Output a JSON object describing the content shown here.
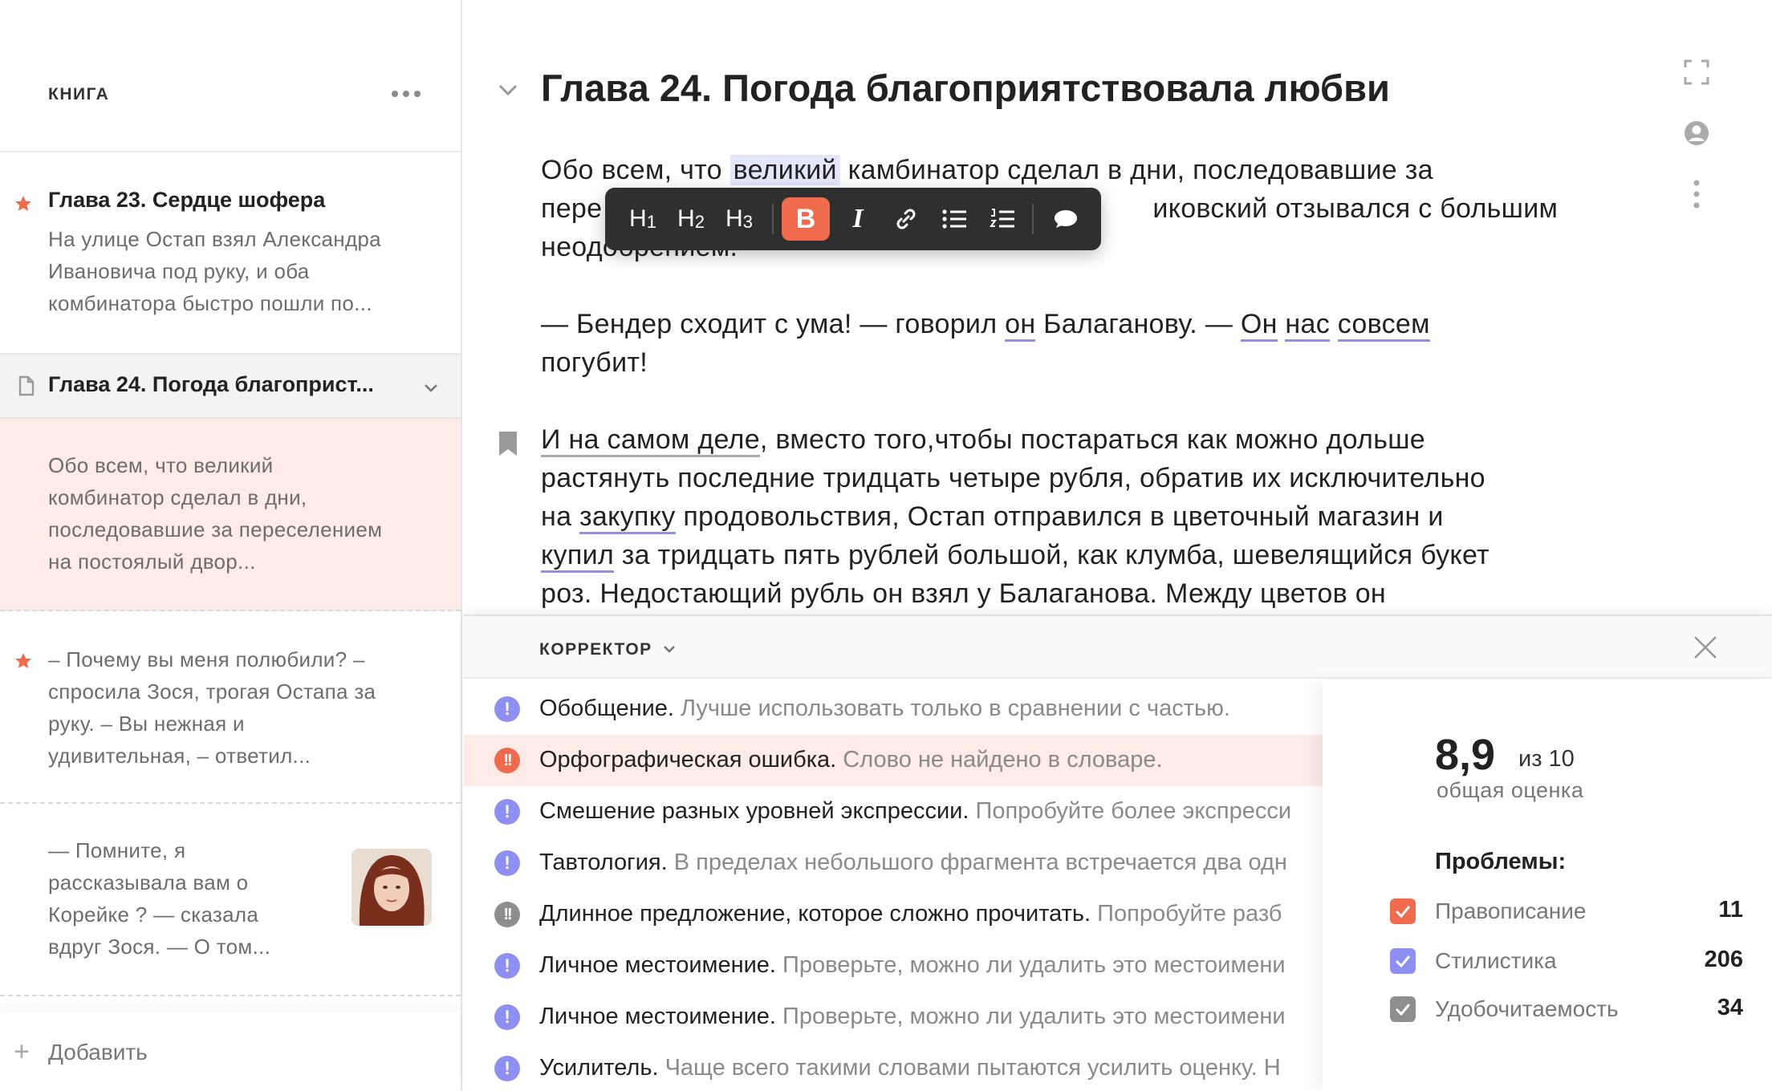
{
  "colors": {
    "accent": "#f06a4e",
    "violet": "#8e8ff2",
    "gray_badge": "#8e8e8e",
    "highlight": "#fdebe8"
  },
  "sidebar": {
    "title": "КНИГА",
    "items": [
      {
        "title": "Глава 23. Сердце шофера",
        "text_lines": [
          "На улице Остап взял Александра",
          "Ивановича под руку, и оба",
          "комбинатора быстро пошли по..."
        ],
        "starred": true
      },
      {
        "title": "Глава 24. Погода благоприст...",
        "icon": "document-icon"
      },
      {
        "text_lines": [
          "Обо всем, что великий",
          "комбинатор сделал в дни,",
          "последовавшие за переселением",
          "на постоялый двор..."
        ]
      },
      {
        "text_lines": [
          "– Почему вы меня полюбили? –",
          "спросила Зося, трогая Остапа за",
          "руку. – Вы нежная и",
          "удивительная, – ответил..."
        ],
        "starred": true
      },
      {
        "text_lines": [
          "— Помните, я",
          "рассказывала вам о",
          "Корейке ? — сказала",
          "вдруг Зося. — О том..."
        ],
        "has_avatar": true
      }
    ],
    "add_label": "Добавить"
  },
  "editor": {
    "title": "Глава 24. Погода благоприятствовала любви",
    "p1": {
      "a": "Обо всем, что ",
      "b": "великий",
      "c": " камбинатор сделал в дни, последовавшие за",
      "d": "пере",
      "e": "иковский отзывался с большим",
      "f": "неодобрением."
    },
    "p2": {
      "a": "— Бендер сходит с ума! — говорил ",
      "b": "он",
      "c": " Балаганову. — ",
      "d": "Он",
      "e": " ",
      "f": "нас",
      "g": " ",
      "h": "совсем",
      "i": "погубит!"
    },
    "p3": {
      "a": "И на самом деле",
      "b": ", вместо того,чтобы постараться как можно дольше",
      "c": "растянуть последние тридцать четыре рубля, обратив их исключительно",
      "d": "на ",
      "e": "закупку",
      "f": " продовольствия, Остап отправился в цветочный магазин и",
      "g": "купил",
      "h": " за тридцать пять рублей большой, как клумба, шевелящийся букет",
      "i": "роз. Недостающий рубль он взял у Балаганова. Между цветов он"
    },
    "toolbar": {
      "h1": "H",
      "h1n": "1",
      "h2": "H",
      "h2n": "2",
      "h3": "H",
      "h3n": "3",
      "bold": "B",
      "italic": "I"
    }
  },
  "corrector": {
    "title": "КОРРЕКТОР",
    "issues": [
      {
        "title": "Обобщение.",
        "desc": " Лучше использовать только в сравнении с частью.",
        "type": "style"
      },
      {
        "title": "Орфографическая ошибка.",
        "desc": " Слово не найдено в словаре.",
        "type": "spelling"
      },
      {
        "title": "Смешение разных уровней экспрессии.",
        "desc": " Попробуйте более экспресси",
        "type": "style"
      },
      {
        "title": "Тавтология.",
        "desc": " В пределах небольшого фрагмента встречается два одн",
        "type": "style"
      },
      {
        "title": "Длинное предложение, которое сложно прочитать.",
        "desc": " Попробуйте разб",
        "type": "readability"
      },
      {
        "title": "Личное местоимение.",
        "desc": " Проверьте, можно ли удалить это местоимени",
        "type": "style"
      },
      {
        "title": "Личное местоимение.",
        "desc": " Проверьте, можно ли удалить это местоимени",
        "type": "style"
      },
      {
        "title": "Усилитель.",
        "desc": " Чаще всего такими словами пытаются усилить оценку. Н",
        "type": "style"
      }
    ],
    "score": {
      "value": "8,9",
      "of": "из 10",
      "label": "общая оценка"
    },
    "problems_title": "Проблемы:",
    "problems": [
      {
        "name": "Правописание",
        "count": "11"
      },
      {
        "name": "Стилистика",
        "count": "206"
      },
      {
        "name": "Удобочитаемость",
        "count": "34"
      }
    ]
  }
}
